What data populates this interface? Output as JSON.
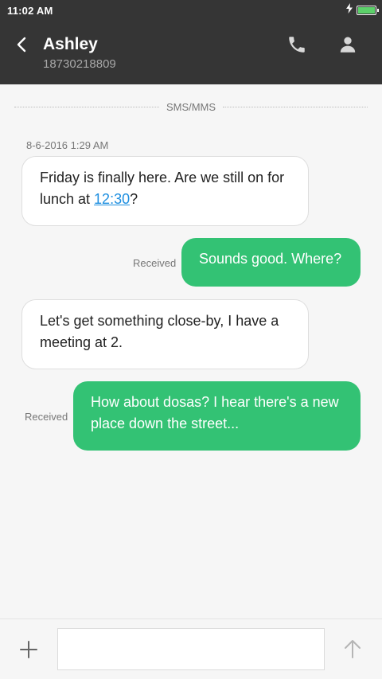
{
  "status_bar": {
    "time": "11:02 AM",
    "battery_level": 1.0,
    "charging": true
  },
  "header": {
    "contact_name": "Ashley",
    "contact_number": "18730218809",
    "icons": {
      "back": "chevron-left-icon",
      "call": "phone-icon",
      "profile": "person-icon"
    }
  },
  "conversation": {
    "channel_label": "SMS/MMS",
    "timestamp": "8-6-2016 1:29 AM",
    "messages": [
      {
        "direction": "incoming",
        "text_before": "Friday is finally here. Are we still on for lunch at ",
        "link": "12:30",
        "text_after": "?"
      },
      {
        "direction": "outgoing",
        "status": "Received",
        "text": "Sounds good. Where?"
      },
      {
        "direction": "incoming",
        "text": "Let's get something close-by, I have a meeting at 2."
      },
      {
        "direction": "outgoing",
        "status": "Received",
        "text": "How about dosas? I hear there's a new place down the street..."
      }
    ]
  },
  "compose": {
    "input_value": "",
    "icons": {
      "add": "plus-icon",
      "send": "arrow-up-icon"
    }
  },
  "colors": {
    "toolbar": "#353535",
    "outgoing_bubble": "#33c274",
    "incoming_bubble": "#ffffff",
    "link": "#1e8fe0",
    "background": "#f6f6f6"
  }
}
